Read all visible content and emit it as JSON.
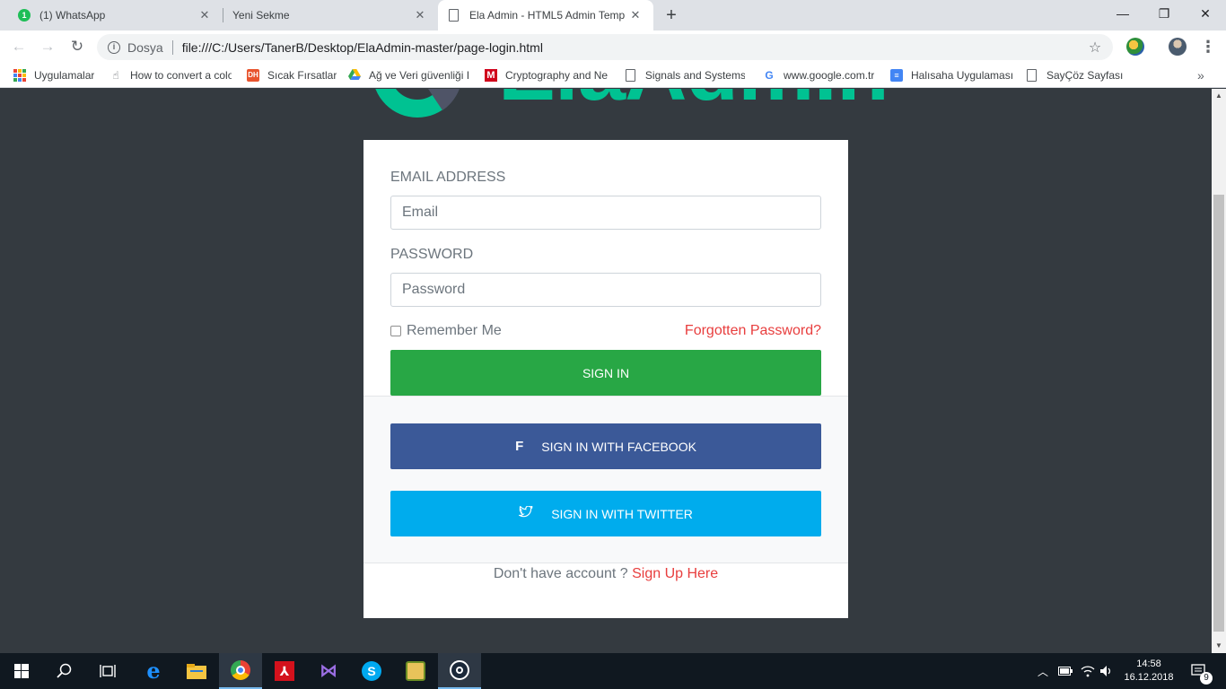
{
  "browser": {
    "tabs": [
      {
        "title": "(1) WhatsApp",
        "favicon": "whatsapp-icon",
        "badge": "1"
      },
      {
        "title": "Yeni Sekme",
        "favicon": "none"
      },
      {
        "title": "Ela Admin - HTML5 Admin Temp",
        "favicon": "document-icon",
        "active": true
      }
    ],
    "window_controls": {
      "minimize": "—",
      "maximize": "❐",
      "close": "✕"
    },
    "omnibox": {
      "security_label": "Dosya",
      "url": "file:///C:/Users/TanerB/Desktop/ElaAdmin-master/page-login.html"
    },
    "bookmarks": [
      {
        "label": "Uygulamalar",
        "icon": "apps-grid-icon"
      },
      {
        "label": "How to convert a colo",
        "icon": "hand-icon"
      },
      {
        "label": "Sıcak Fırsatlar",
        "icon": "dh-icon"
      },
      {
        "label": "Ağ ve Veri güvenliği I",
        "icon": "google-drive-icon"
      },
      {
        "label": "Cryptography and Ne",
        "icon": "m-icon"
      },
      {
        "label": "Signals and Systems",
        "icon": "document-icon"
      },
      {
        "label": "www.google.com.tr",
        "icon": "google-icon"
      },
      {
        "label": "Halısaha Uygulaması",
        "icon": "google-docs-icon"
      },
      {
        "label": "SayÇöz Sayfası",
        "icon": "document-icon"
      }
    ]
  },
  "logo": {
    "text": "ElaAdmin",
    "accent": "#00c292"
  },
  "login": {
    "email_label": "EMAIL ADDRESS",
    "email_placeholder": "Email",
    "password_label": "PASSWORD",
    "password_placeholder": "Password",
    "remember_label": "Remember Me",
    "forgot_label": "Forgotten Password?",
    "signin_label": "Sign in",
    "facebook_label": "Sign in with facebook",
    "twitter_label": "Sign in with twitter",
    "no_account_text": "Don't have account ?",
    "signup_link": "Sign Up Here"
  },
  "colors": {
    "page_bg": "#343a40",
    "signin": "#28a745",
    "facebook": "#3b5998",
    "twitter": "#00aced",
    "link": "#e83e3e"
  },
  "taskbar": {
    "items": [
      "windows-start-icon",
      "search-icon",
      "task-view-icon",
      "edge-icon",
      "file-explorer-icon",
      "chrome-icon",
      "acrobat-icon",
      "visual-studio-icon",
      "skype-icon",
      "app-icon",
      "steam-icon"
    ],
    "clock_time": "14:58",
    "clock_date": "16.12.2018",
    "notification_count": "9"
  }
}
